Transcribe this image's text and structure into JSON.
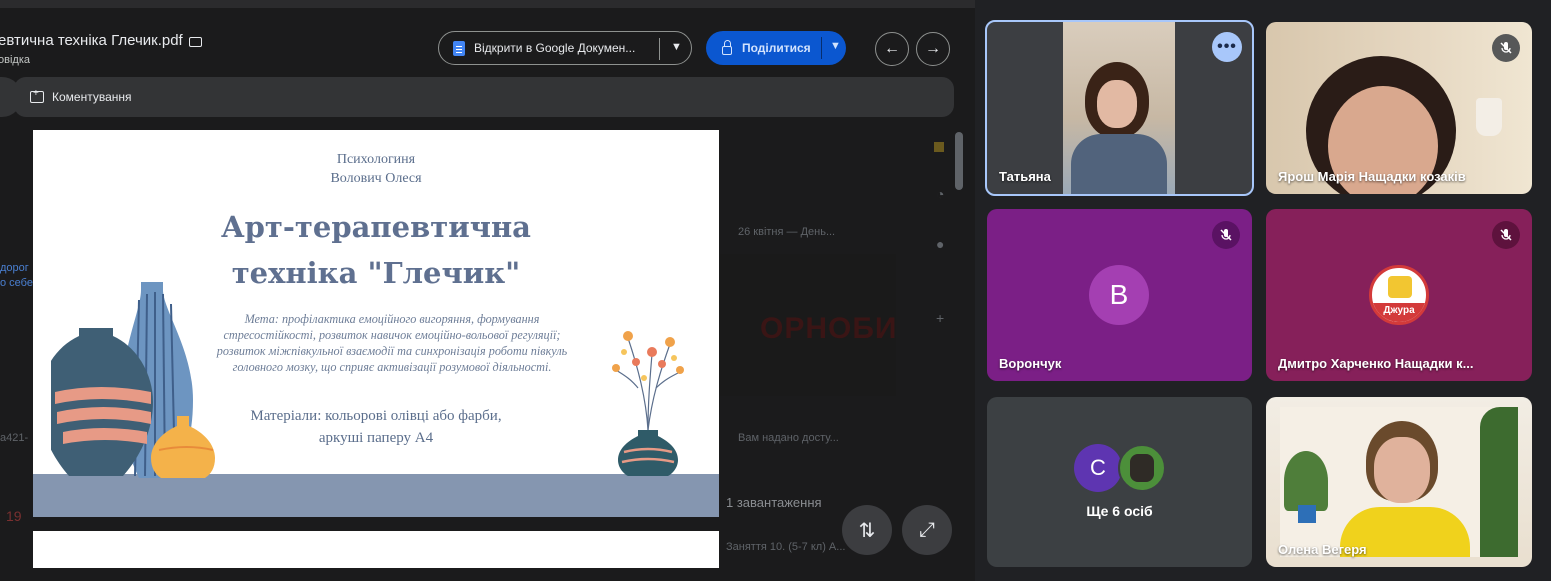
{
  "document": {
    "title": "евтична техніка Глечик.pdf",
    "subtitle": "овідка",
    "open_in_docs_label": "Відкрити в Google Докумен...",
    "share_label": "Поділитися",
    "comment_label": "Коментування"
  },
  "slide": {
    "author_line1": "Психологиня",
    "author_line2": "Волович Олеся",
    "title_line1": "Арт-терапевтична",
    "title_line2": "техніка \"Глечик\"",
    "goal_text": "Мета: профілактика емоційного вигоряння, формування стресостійкості, розвиток навичок емоційно-вольової регуляції; розвиток міжпівкульної взаємодії та синхронізація роботи півкуль головного мозку, що сприяє активізації розумової діяльності.",
    "materials_line1": "Матеріали: кольорові олівці або фарби,",
    "materials_line2": "аркуші паперу А4"
  },
  "background_doc": {
    "item1": "26 квітня — День...",
    "item2": "Вам надано досту...",
    "item3": "1 завантаження",
    "item4": "Заняття 10. (5-7 кл) А...",
    "thumb_text": "ОРНОБИЛЬ",
    "left_text1": "дорог",
    "left_text2": "о себе",
    "left_text3": "а421-",
    "left_text4": "19"
  },
  "participants": [
    {
      "name": "Татьяна",
      "muted": false,
      "active": true
    },
    {
      "name": "Ярош Марія Нащадки козаків",
      "muted": true
    },
    {
      "name": "Ворончук",
      "muted": true,
      "initial": "В"
    },
    {
      "name": "Дмитро Харченко Нащадки к...",
      "muted": true,
      "logo_text": "Джура"
    },
    {
      "name": "Ще 6 осіб",
      "initial": "С"
    },
    {
      "name": "Олена Вегеря",
      "muted": false
    }
  ],
  "colors": {
    "accent_blue": "#0b57d0",
    "tile_purple": "#7b1f86",
    "tile_magenta": "#86205a",
    "active_border": "#a8c7fa"
  }
}
